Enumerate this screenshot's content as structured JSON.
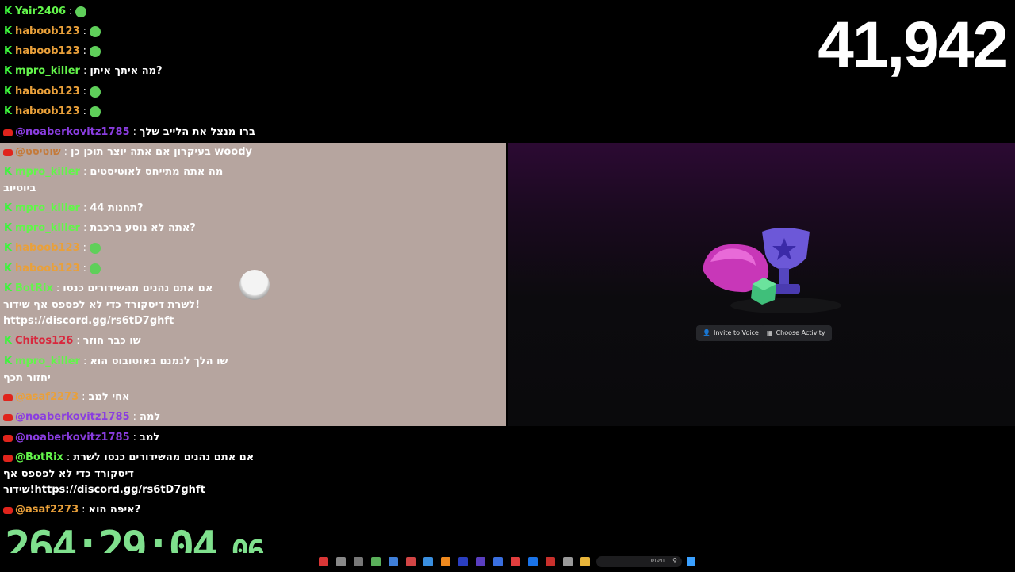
{
  "viewer_count": "41,942",
  "timer": {
    "main": "264:29:04",
    "fraction": ".06"
  },
  "colors": {
    "kick": "#3cf53c",
    "youtube": "#e0241c",
    "timer": "#7fe08d",
    "viewer": "#ffffff"
  },
  "chat_top": [
    {
      "source": "kick",
      "user": "Yair2406",
      "color": "#63f54b",
      "text": ""
    },
    {
      "source": "kick",
      "user": "haboob123",
      "color": "#e9a03a",
      "text": ""
    },
    {
      "source": "kick",
      "user": "haboob123",
      "color": "#e9a03a",
      "text": ""
    },
    {
      "source": "kick",
      "user": "mpro_killer",
      "color": "#63f54b",
      "text": "מה איתך איתן?"
    },
    {
      "source": "kick",
      "user": "haboob123",
      "color": "#e9a03a",
      "text": ""
    },
    {
      "source": "kick",
      "user": "haboob123",
      "color": "#e9a03a",
      "text": ""
    },
    {
      "source": "youtube",
      "user": "@noaberkovitz1785",
      "color": "#8a3de0",
      "text": "ברו מנצל את הלייב שלך"
    }
  ],
  "chat_overlay": [
    {
      "source": "youtube",
      "user": "@שוטיסט",
      "color": "#c47a3a",
      "text": "בעיקרון אם אתה יוצר תוכן כן woody"
    },
    {
      "source": "kick",
      "user": "mpro_killer",
      "color": "#63f54b",
      "text": "מה אתה מתייחס לאוטיסטים",
      "cont": "ביוטיוב"
    },
    {
      "source": "kick",
      "user": "mpro_killer",
      "color": "#63f54b",
      "text": "תחנות 44?"
    },
    {
      "source": "kick",
      "user": "mpro_killer",
      "color": "#63f54b",
      "text": "אתה לא נוסע ברכבת?"
    },
    {
      "source": "kick",
      "user": "haboob123",
      "color": "#e9a03a",
      "text": ""
    },
    {
      "source": "kick",
      "user": "haboob123",
      "color": "#e9a03a",
      "text": ""
    },
    {
      "source": "kick",
      "user": "BotRix",
      "color": "#63f54b",
      "text": "אם אתם נהנים מהשידורים כנסו",
      "cont": "לשרת דיסקורד כדי לא לפספס אף שידור!",
      "cont2": "https://discord.gg/rs6tD7ghft"
    },
    {
      "source": "kick",
      "user": "Chitos126",
      "color": "#d8283d",
      "text": "שו כבר חוזר"
    },
    {
      "source": "kick",
      "user": "mpro_killer",
      "color": "#63f54b",
      "text": "שו הלך לנמנם באוטובוס הוא",
      "cont": "יחזור תכף"
    },
    {
      "source": "youtube",
      "user": "@asaf2273",
      "color": "#e9a03a",
      "text": "אחי למב"
    },
    {
      "source": "youtube",
      "user": "@noaberkovitz1785",
      "color": "#8a3de0",
      "text": "למה"
    }
  ],
  "chat_bottom": [
    {
      "source": "youtube",
      "user": "@noaberkovitz1785",
      "color": "#8a3de0",
      "text": "למב"
    },
    {
      "source": "youtube",
      "user": "@BotRix",
      "color": "#63f54b",
      "text": "אם אתם נהנים מהשידורים כנסו לשרת",
      "cont": "דיסקורד כדי לא לפספס אף",
      "cont2": "שידור!https://discord.gg/rs6tD7ghft"
    },
    {
      "source": "youtube",
      "user": "@asaf2273",
      "color": "#e9a03a",
      "text": "איפה הוא?"
    }
  ],
  "discord": {
    "invite_label": "Invite to Voice",
    "activity_label": "Choose Activity"
  },
  "taskbar": {
    "search_label": "חיפוש"
  }
}
